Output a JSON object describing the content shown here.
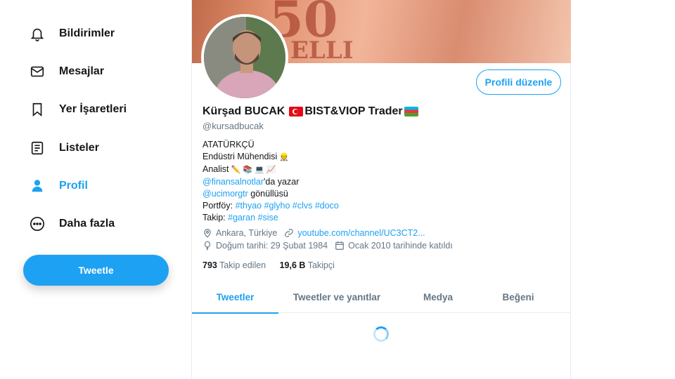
{
  "sidebar": {
    "items": [
      {
        "label": "Bildirimler",
        "icon": "bell-icon"
      },
      {
        "label": "Mesajlar",
        "icon": "mail-icon"
      },
      {
        "label": "Yer İşaretleri",
        "icon": "bookmark-icon"
      },
      {
        "label": "Listeler",
        "icon": "list-icon"
      },
      {
        "label": "Profil",
        "icon": "person-icon",
        "active": true
      },
      {
        "label": "Daha fazla",
        "icon": "more-icon"
      }
    ],
    "tweet_button": "Tweetle"
  },
  "profile": {
    "banner_text": "50",
    "banner_subtext": "ELLI",
    "edit_button": "Profili düzenle",
    "name": "Kürşad BUCAK",
    "name_suffix": "BIST&VIOP Trader",
    "handle": "@kursadbucak",
    "bio": {
      "line1": "ATATÜRKÇÜ",
      "line2": "Endüstri Mühendisi",
      "line3": "Analist",
      "line4_link": "@finansalnotlar",
      "line4_text": "'da yazar",
      "line5_link": "@ucimorgtr",
      "line5_text": " gönüllüsü",
      "line6_label": "Portföy:",
      "line6_tags": "#thyao #glyho #clvs #doco",
      "line7_label": "Takip:",
      "line7_tags": "#garan #sise"
    },
    "location": "Ankara, Türkiye",
    "website": "youtube.com/channel/UC3CT2...",
    "birthday": "Doğum tarihi: 29 Şubat 1984",
    "joined": "Ocak 2010 tarihinde katıldı",
    "following_count": "793",
    "following_label": "Takip edilen",
    "followers_count": "19,6 B",
    "followers_label": "Takipçi"
  },
  "tabs": [
    {
      "label": "Tweetler",
      "active": true
    },
    {
      "label": "Tweetler ve yanıtlar"
    },
    {
      "label": "Medya"
    },
    {
      "label": "Beğeni"
    }
  ],
  "colors": {
    "accent": "#1da1f2",
    "text": "#14171a",
    "muted": "#657786"
  }
}
